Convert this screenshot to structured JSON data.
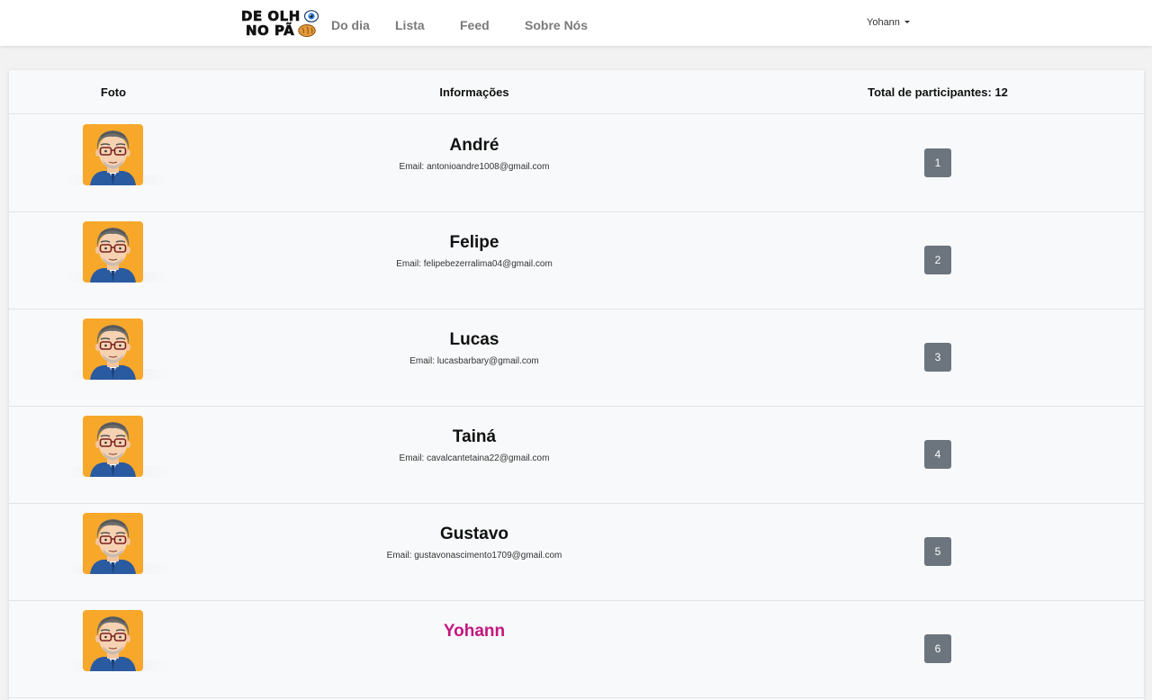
{
  "navbar": {
    "brand": {
      "line1": "DE OLH",
      "line2": "NO PÃ",
      "eye_icon": "eye-icon",
      "bread_icon": "bread-icon"
    },
    "links": [
      "Do dia",
      "Lista",
      "Feed",
      "Sobre Nós"
    ],
    "user": "Yohann",
    "user_caret_icon": "caret-down-icon"
  },
  "table": {
    "headers": {
      "photo": "Foto",
      "info": "Informações",
      "total": "Total de participantes: 12"
    },
    "rows": [
      {
        "name": "André",
        "email": "Email: antonioandre1008@gmail.com",
        "position": "1"
      },
      {
        "name": "Felipe",
        "email": "Email: felipebezerralima04@gmail.com",
        "position": "2"
      },
      {
        "name": "Lucas",
        "email": "Email: lucasbarbary@gmail.com",
        "position": "3"
      },
      {
        "name": "Tainá",
        "email": "Email: cavalcantetaina22@gmail.com",
        "position": "4"
      },
      {
        "name": "Gustavo",
        "email": "Email: gustavonascimento1709@gmail.com",
        "position": "5"
      },
      {
        "name": "Yohann",
        "email": "",
        "position": "6",
        "highlighted": true
      }
    ]
  },
  "colors": {
    "highlight_name": "#c2177f",
    "badge": "#6c757d",
    "avatar_background": "#f7a82b",
    "avatar_shirt": "#2a5aa0"
  }
}
